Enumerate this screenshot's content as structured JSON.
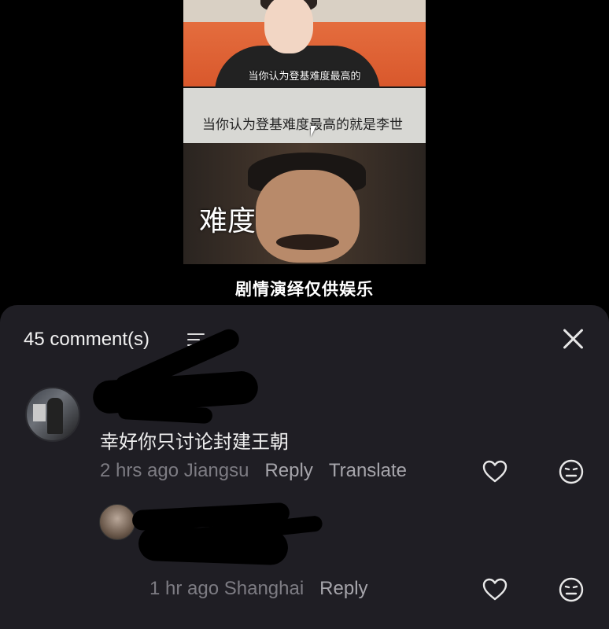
{
  "video": {
    "caption_small": "当你认为登基难度最高的",
    "page_text": "当你认为登基难度最高的就是李世",
    "scene_label": "难度",
    "caption_big": "剧情演绎仅供娱乐"
  },
  "comments_panel": {
    "count_label": "45 comment(s)",
    "sort_icon": "filter-lines-icon",
    "close_icon": "close-icon"
  },
  "comments": [
    {
      "author": "",
      "text": "幸好你只讨论封建王朝",
      "time_location": "2 hrs ago Jiangsu",
      "reply_label": "Reply",
      "translate_label": "Translate"
    },
    {
      "author": "",
      "text": "",
      "time_location": "1 hr ago Shanghai",
      "reply_label": "Reply"
    }
  ],
  "colors": {
    "panel_bg": "#1f1e24",
    "meta_text": "#7d7c83",
    "action_text": "#a6a5ab"
  }
}
